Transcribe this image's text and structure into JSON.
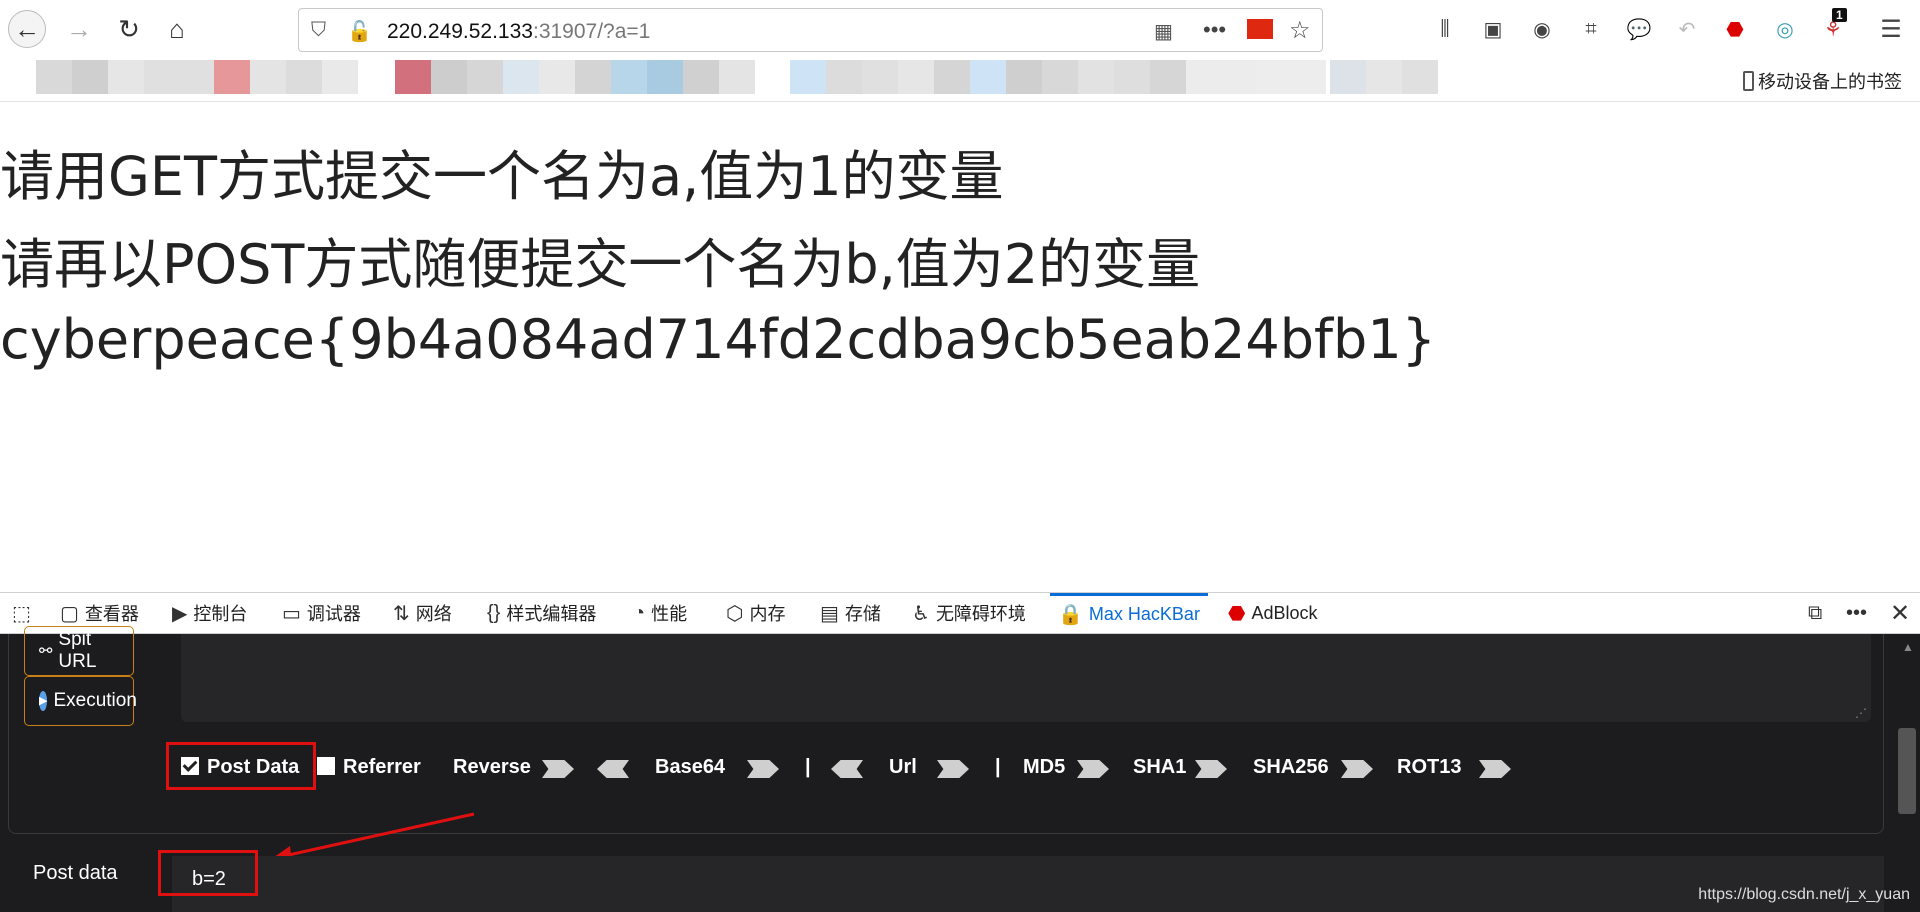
{
  "browser": {
    "url_host": "220.249.52.133",
    "url_rest": ":31907/?a=1",
    "mobile_bookmarks": "移动设备上的书签",
    "badge_count": "1"
  },
  "page": {
    "line1": "请用GET方式提交一个名为a,值为1的变量",
    "line2": "请再以POST方式随便提交一个名为b,值为2的变量",
    "line3": "cyberpeace{9b4a084ad714fd2cdba9cb5eab24bfb1}"
  },
  "devtools": {
    "tabs": [
      "查看器",
      "控制台",
      "调试器",
      "网络",
      "样式编辑器",
      "性能",
      "内存",
      "存储",
      "无障碍环境",
      "Max HacKBar",
      "AdBlock"
    ]
  },
  "hackbar": {
    "split_url": "Spit URL",
    "execution": "Execution",
    "post_data_opt": "Post Data",
    "referrer_opt": "Referrer",
    "reverse": "Reverse",
    "base64": "Base64",
    "sep": "|",
    "url": "Url",
    "md5": "MD5",
    "sha1": "SHA1",
    "sha256": "SHA256",
    "rot13": "ROT13",
    "post_label": "Post data",
    "post_value": "b=2"
  },
  "watermark": "https://blog.csdn.net/j_x_yuan"
}
